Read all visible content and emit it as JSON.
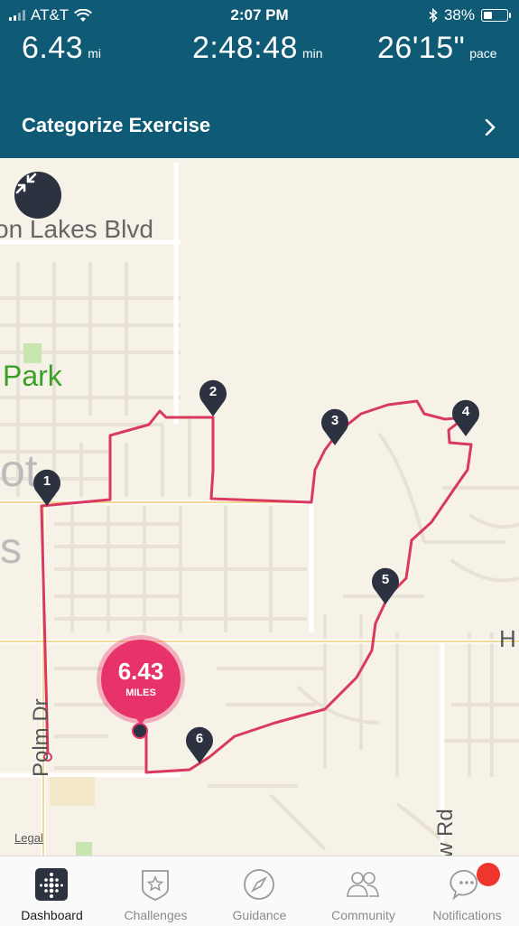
{
  "status_bar": {
    "carrier": "AT&T",
    "time": "2:07 PM",
    "battery": "38%"
  },
  "stats": {
    "distance": {
      "value": "6.43",
      "unit": "mi"
    },
    "duration": {
      "value": "2:48:48",
      "unit": "min"
    },
    "pace": {
      "value": "26'15\"",
      "unit": "pace"
    }
  },
  "categorize": {
    "label": "Categorize Exercise"
  },
  "map": {
    "labels": {
      "blvd": "on Lakes Blvd",
      "park": "Park",
      "polm": "Polm Dr",
      "w_rd": "w Rd",
      "h": "H",
      "ot": "ot",
      "s": "s"
    },
    "legal": "Legal",
    "markers": [
      "1",
      "2",
      "3",
      "4",
      "5",
      "6"
    ],
    "summary": {
      "value": "6.43",
      "unit": "MILES"
    },
    "route_color": "#d9395f"
  },
  "tabs": [
    {
      "label": "Dashboard",
      "icon": "dashboard-icon",
      "active": true
    },
    {
      "label": "Challenges",
      "icon": "challenges-icon",
      "active": false
    },
    {
      "label": "Guidance",
      "icon": "compass-icon",
      "active": false
    },
    {
      "label": "Community",
      "icon": "community-icon",
      "active": false
    },
    {
      "label": "Notifications",
      "icon": "notifications-icon",
      "active": false
    }
  ],
  "colors": {
    "header": "#0f5b76",
    "map_bg": "#f7f2e8",
    "accent": "#e8336a",
    "notification": "#f0352f"
  }
}
